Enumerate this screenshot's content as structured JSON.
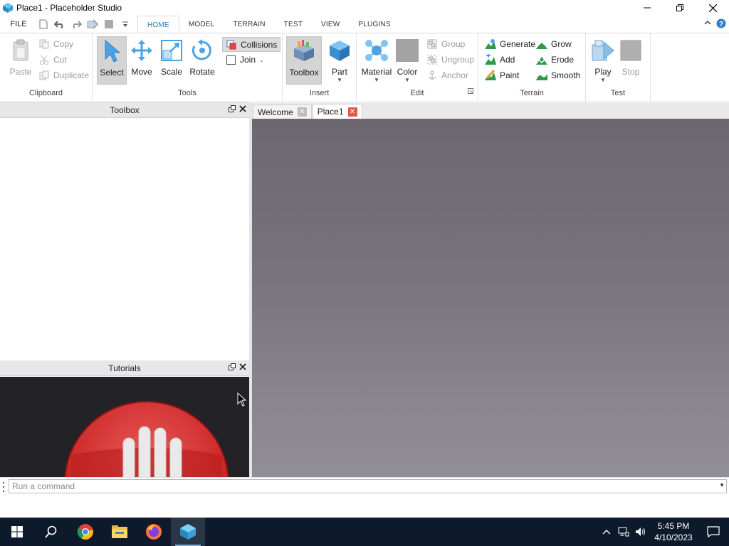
{
  "window": {
    "title": "Place1 - Placeholder Studio",
    "controls": [
      "minimize",
      "restore",
      "close"
    ]
  },
  "ribbon_tabs": {
    "file": "FILE",
    "tabs": [
      {
        "label": "HOME",
        "active": true
      },
      {
        "label": "MODEL",
        "active": false
      },
      {
        "label": "TERRAIN",
        "active": false
      },
      {
        "label": "TEST",
        "active": false
      },
      {
        "label": "VIEW",
        "active": false
      },
      {
        "label": "PLUGINS",
        "active": false
      }
    ]
  },
  "clipboard": {
    "label": "Clipboard",
    "paste": "Paste",
    "copy": "Copy",
    "cut": "Cut",
    "duplicate": "Duplicate"
  },
  "tools": {
    "label": "Tools",
    "select": "Select",
    "move": "Move",
    "scale": "Scale",
    "rotate": "Rotate",
    "collisions": "Collisions",
    "join": "Join"
  },
  "insert": {
    "label": "Insert",
    "toolbox": "Toolbox",
    "part": "Part"
  },
  "edit": {
    "label": "Edit",
    "material": "Material",
    "color": "Color",
    "group": "Group",
    "ungroup": "Ungroup",
    "anchor": "Anchor"
  },
  "terrain": {
    "label": "Terrain",
    "generate": "Generate",
    "add": "Add",
    "paint": "Paint",
    "grow": "Grow",
    "erode": "Erode",
    "smooth": "Smooth"
  },
  "test": {
    "label": "Test",
    "play": "Play",
    "stop": "Stop"
  },
  "panels": {
    "toolbox_title": "Toolbox",
    "tutorials_title": "Tutorials"
  },
  "doc_tabs": [
    {
      "label": "Welcome",
      "active": false
    },
    {
      "label": "Place1",
      "active": true
    }
  ],
  "command_bar": {
    "placeholder": "Run a command"
  },
  "taskbar": {
    "time": "5:45 PM",
    "date": "4/10/2023"
  },
  "colors": {
    "accent": "#2b7fc9",
    "close_tab": "#e2594a",
    "viewport_top": "#6c6771",
    "viewport_bottom": "#928e98",
    "taskbar": "#0d1a2b"
  }
}
